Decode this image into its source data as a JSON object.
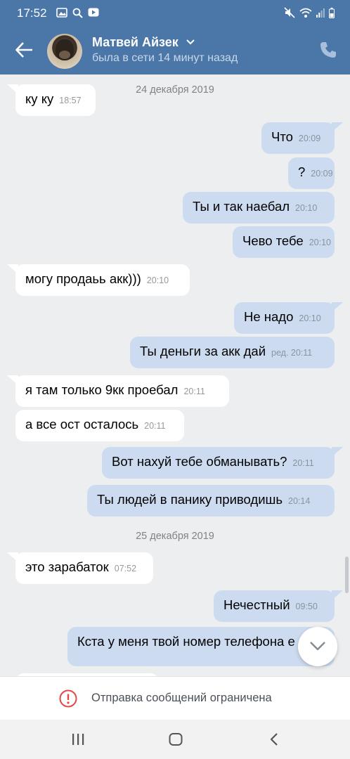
{
  "status": {
    "time": "17:52"
  },
  "header": {
    "name": "Матвей Айзек",
    "last_seen": "была в сети 14 минут назад"
  },
  "dates": [
    "24 декабря 2019",
    "25 декабря 2019"
  ],
  "messages": [
    {
      "dir": "in",
      "text": "ку ку",
      "time": "18:57"
    },
    {
      "dir": "out",
      "text": "Что",
      "time": "20:09"
    },
    {
      "dir": "out",
      "text": "?",
      "time": "20:09"
    },
    {
      "dir": "out",
      "text": "Ты и так наебал",
      "time": "20:10"
    },
    {
      "dir": "out",
      "text": "Чево тебе",
      "time": "20:10"
    },
    {
      "dir": "in",
      "text": "могу продаьь акк)))",
      "time": "20:10"
    },
    {
      "dir": "out",
      "text": "Не надо",
      "time": "20:10"
    },
    {
      "dir": "out",
      "text": "Ты деньги за акк дай",
      "time": "ред. 20:11"
    },
    {
      "dir": "in",
      "text": "я там только 9кк проебал",
      "time": "20:11"
    },
    {
      "dir": "in",
      "text": "а все ост осталось",
      "time": "20:11"
    },
    {
      "dir": "out",
      "text": "Вот нахуй тебе обманывать?",
      "time": "20:11"
    },
    {
      "dir": "out",
      "text": "Ты людей в панику приводишь",
      "time": "20:14"
    },
    {
      "dir": "in",
      "text": "это зарабаток",
      "time": "07:52"
    },
    {
      "dir": "out",
      "text": "Нечестный",
      "time": "09:50"
    },
    {
      "dir": "out",
      "text": "Кста у меня твой номер телефона е",
      "time": ""
    }
  ],
  "restriction": {
    "text": "Отправка сообщений ограничена"
  }
}
